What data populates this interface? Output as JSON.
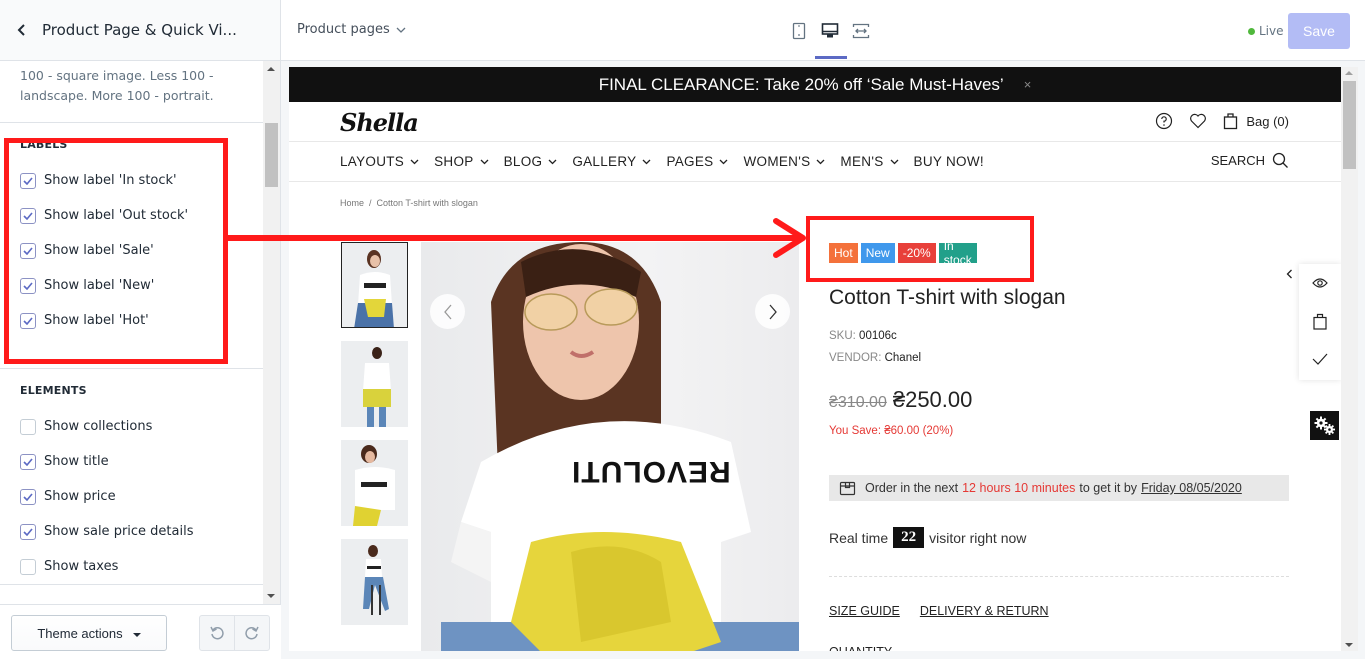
{
  "sidebar": {
    "title": "Product Page & Quick Vi...",
    "note": "100 - square image. Less 100 - landscape. More 100 - portrait.",
    "sections": [
      {
        "heading": "LABELS",
        "items": [
          {
            "label": "Show label 'In stock'",
            "checked": true
          },
          {
            "label": "Show label 'Out stock'",
            "checked": true
          },
          {
            "label": "Show label 'Sale'",
            "checked": true
          },
          {
            "label": "Show label 'New'",
            "checked": true
          },
          {
            "label": "Show label 'Hot'",
            "checked": true
          }
        ]
      },
      {
        "heading": "ELEMENTS",
        "items": [
          {
            "label": "Show collections",
            "checked": false
          },
          {
            "label": "Show title",
            "checked": true
          },
          {
            "label": "Show price",
            "checked": true
          },
          {
            "label": "Show sale price details",
            "checked": true
          },
          {
            "label": "Show taxes",
            "checked": false
          }
        ]
      }
    ],
    "footer": {
      "theme_actions": "Theme actions"
    }
  },
  "topbar": {
    "template_select": "Product pages",
    "devices": [
      "mobile",
      "desktop",
      "full-width"
    ],
    "active_device": "desktop",
    "status": "Live",
    "save_label": "Save"
  },
  "preview": {
    "promo": "FINAL CLEARANCE: Take 20% off ‘Sale Must-Haves’",
    "promo_close": "×",
    "logo": "Shella",
    "bag": "Bag (0)",
    "nav": [
      "LAYOUTS",
      "SHOP",
      "BLOG",
      "GALLERY",
      "PAGES",
      "WOMEN'S",
      "MEN'S",
      "BUY NOW!"
    ],
    "nav_has_dropdown": [
      true,
      true,
      true,
      true,
      true,
      true,
      true,
      false
    ],
    "search": "SEARCH",
    "breadcrumb": {
      "home": "Home",
      "separator": "/",
      "current": "Cotton T-shirt with slogan"
    },
    "product": {
      "badges": [
        {
          "text": "Hot",
          "color": "#f4713b"
        },
        {
          "text": "New",
          "color": "#3f98ec"
        },
        {
          "text": "-20%",
          "color": "#e8403a"
        },
        {
          "text": "In stock",
          "color": "#22a08a"
        }
      ],
      "title": "Cotton T-shirt with slogan",
      "sku_label": "SKU:",
      "sku": "00106c",
      "vendor_label": "VENDOR:",
      "vendor": "Chanel",
      "old_price": "₴310.00",
      "price": "₴250.00",
      "you_save": "You Save: ₴60.00 (20%)",
      "delivery": {
        "prefix": "Order in the next",
        "highlight": "12 hours 10 minutes",
        "middle": "to get it by",
        "date": "Friday 08/05/2020"
      },
      "visitors": {
        "prefix": "Real time",
        "count": "22",
        "suffix": "visitor right now"
      },
      "links": [
        "SIZE GUIDE",
        "DELIVERY & RETURN"
      ],
      "quantity_label": "QUANTITY",
      "shirt_print": "REVOLUTI"
    }
  },
  "annotation": {
    "color": "#ff1a1a"
  }
}
